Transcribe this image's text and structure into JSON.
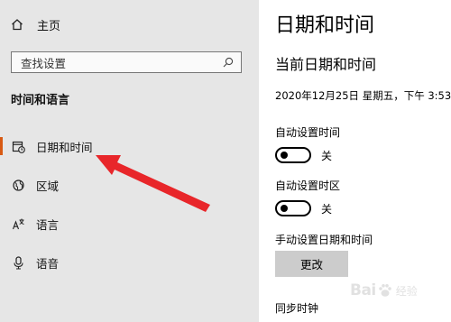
{
  "sidebar": {
    "home_label": "主页",
    "search_placeholder": "查找设置",
    "section_title": "时间和语言",
    "items": [
      {
        "label": "日期和时间",
        "icon": "date-time-icon",
        "selected": true
      },
      {
        "label": "区域",
        "icon": "region-globe-icon",
        "selected": false
      },
      {
        "label": "语言",
        "icon": "language-icon",
        "selected": false
      },
      {
        "label": "语音",
        "icon": "microphone-icon",
        "selected": false
      }
    ]
  },
  "main": {
    "title": "日期和时间",
    "subtitle": "当前日期和时间",
    "current_datetime": "2020年12月25日 星期五，下午 3:53",
    "auto_time": {
      "label": "自动设置时间",
      "state": "关"
    },
    "auto_timezone": {
      "label": "自动设置时区",
      "state": "关"
    },
    "manual": {
      "label": "手动设置日期和时间",
      "button": "更改"
    },
    "sync": {
      "label": "同步时钟"
    }
  },
  "watermark": {
    "text_left": "Bai",
    "text_right": "经验"
  },
  "colors": {
    "accent": "#d85a13",
    "sidebar_bg": "#e6e6e6",
    "arrow": "#e8262a",
    "button_bg": "#cccccc"
  }
}
